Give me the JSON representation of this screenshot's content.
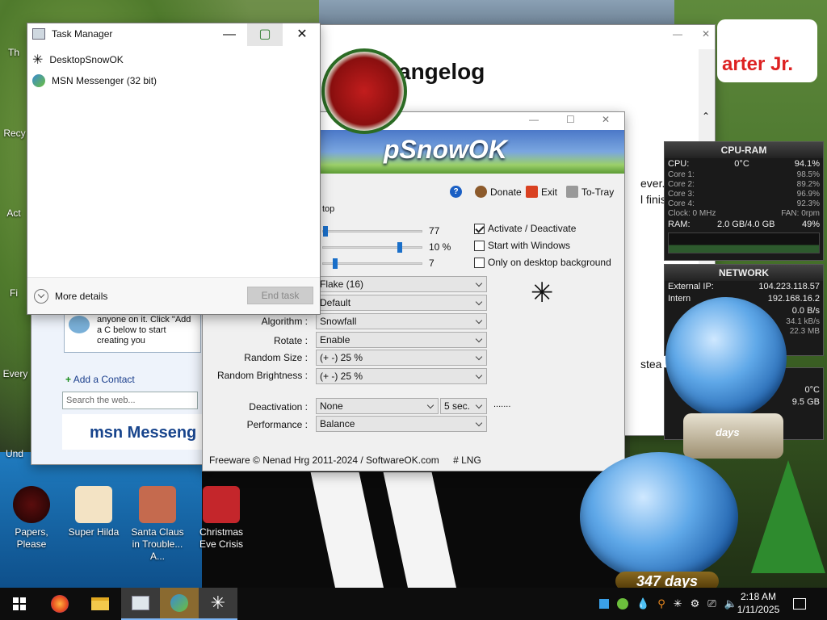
{
  "desktop": {
    "icons": [
      {
        "label": "Papers, Please"
      },
      {
        "label": "Super Hilda"
      },
      {
        "label": "Santa Claus in Trouble... A..."
      },
      {
        "label": "Christmas Eve Crisis"
      }
    ],
    "left_partial": [
      "Th",
      "Recy",
      "Act",
      "Fi",
      "Every",
      "Und"
    ]
  },
  "changelog": {
    "title": "angelog",
    "lines": [
      "ever.",
      "l finish",
      "stea"
    ],
    "banner_text": "arter Jr."
  },
  "msn": {
    "bubble_text": "anyone on it.  Click \"Add a C below to start creating you",
    "add_contact": "Add a Contact",
    "search_placeholder": "Search the web...",
    "logo": "msn Messeng"
  },
  "snow": {
    "banner": "pSnowOK",
    "toolbar": {
      "donate": "Donate",
      "exit": "Exit",
      "totray": "To-Tray"
    },
    "group_label": "top",
    "sliders": [
      {
        "value_label": "77",
        "level": 0.0
      },
      {
        "value_label": "10 %",
        "level": 0.78
      },
      {
        "value_label": "7",
        "level": 0.1
      }
    ],
    "checks": [
      {
        "label": "Activate / Deactivate",
        "checked": true
      },
      {
        "label": "Start with Windows",
        "checked": false
      },
      {
        "label": "Only on desktop background",
        "checked": false
      }
    ],
    "flake_select": "Flake (16)",
    "default_select": "Default",
    "rows": [
      {
        "label": "Algorithm :",
        "value": "Snowfall"
      },
      {
        "label": "Rotate :",
        "value": "Enable"
      },
      {
        "label": "Random Size :",
        "value": "(+ -) 25 %"
      },
      {
        "label": "Random Brightness :",
        "value": "(+ -) 25 %"
      }
    ],
    "deactivation": {
      "label": "Deactivation :",
      "value": "None",
      "secs": "5 sec.",
      "dots": "......."
    },
    "performance": {
      "label": "Performance :",
      "value": "Balance"
    },
    "footer": {
      "freeware": "Freeware © Nenad Hrg 2011-2024 / SoftwareOK.com",
      "lng": "# LNG"
    }
  },
  "taskmanager": {
    "title": "Task Manager",
    "items": [
      "DesktopSnowOK",
      "MSN Messenger (32 bit)"
    ],
    "more_details": "More details",
    "end_task": "End task"
  },
  "cpu_gadget": {
    "title": "CPU-RAM",
    "cpu_label": "CPU:",
    "temp": "0°C",
    "cpu_pct": "94.1%",
    "cores": [
      {
        "name": "Core 1:",
        "val": "98.5%"
      },
      {
        "name": "Core 2:",
        "val": "89.2%"
      },
      {
        "name": "Core 3:",
        "val": "96.9%"
      },
      {
        "name": "Core 4:",
        "val": "92.3%"
      }
    ],
    "clock": "Clock: 0 MHz",
    "fan": "FAN: 0rpm",
    "ram_label": "RAM:",
    "ram_val": "2.0 GB/4.0 GB",
    "ram_pct": "49%"
  },
  "net_gadget": {
    "title": "NETWORK",
    "ext_label": "External IP:",
    "ext_ip": "104.223.118.57",
    "int_label": "Intern",
    "int_ip": "192.168.16.2",
    "rate1": "0.0 B/s",
    "rate2": "34.1 kB/s",
    "rate3": "22.3 MB"
  },
  "extra_gadget": {
    "temp": "0°C",
    "size": "9.5 GB"
  },
  "globe": {
    "days": "347 days",
    "days_small": "days"
  },
  "taskbar": {
    "time": "2:18 AM",
    "date": "1/11/2025"
  }
}
